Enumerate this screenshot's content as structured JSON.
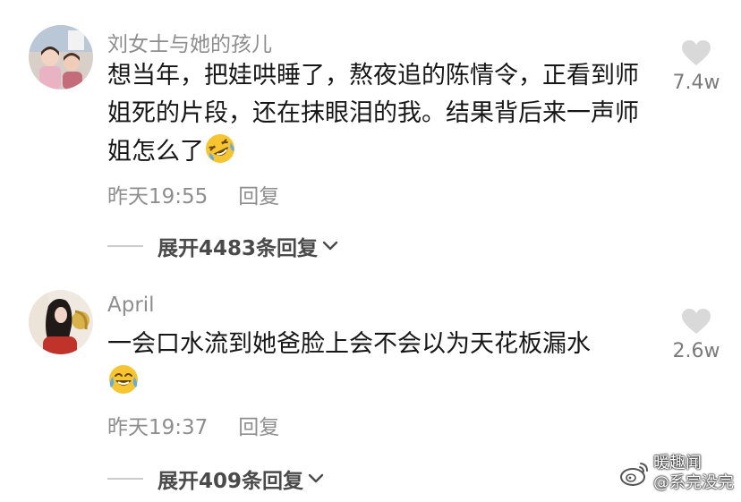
{
  "comments": [
    {
      "username": "刘女士与她的孩儿",
      "text": "想当年，把娃哄睡了，熬夜追的陈情令，正看到师姐死的片段，还在抹眼泪的我。结果背后来一声师姐怎么了",
      "emoji": "rolling-laughing-emoji",
      "time": "昨天19:55",
      "reply_label": "回复",
      "likes": "7.4w",
      "expand_label": "展开4483条回复"
    },
    {
      "username": "April",
      "text": "一会口水流到她爸脸上会不会以为天花板漏水",
      "emoji": "crying-laughing-emoji",
      "time": "昨天19:37",
      "reply_label": "回复",
      "likes": "2.6w",
      "expand_label": "展开409条回复"
    }
  ],
  "watermark": {
    "line1": "暖趣闻",
    "line2": "@系完没完"
  },
  "colors": {
    "secondary_text": "#8e8e8e",
    "primary_text": "#161616",
    "heart": "#d9d9d9"
  }
}
